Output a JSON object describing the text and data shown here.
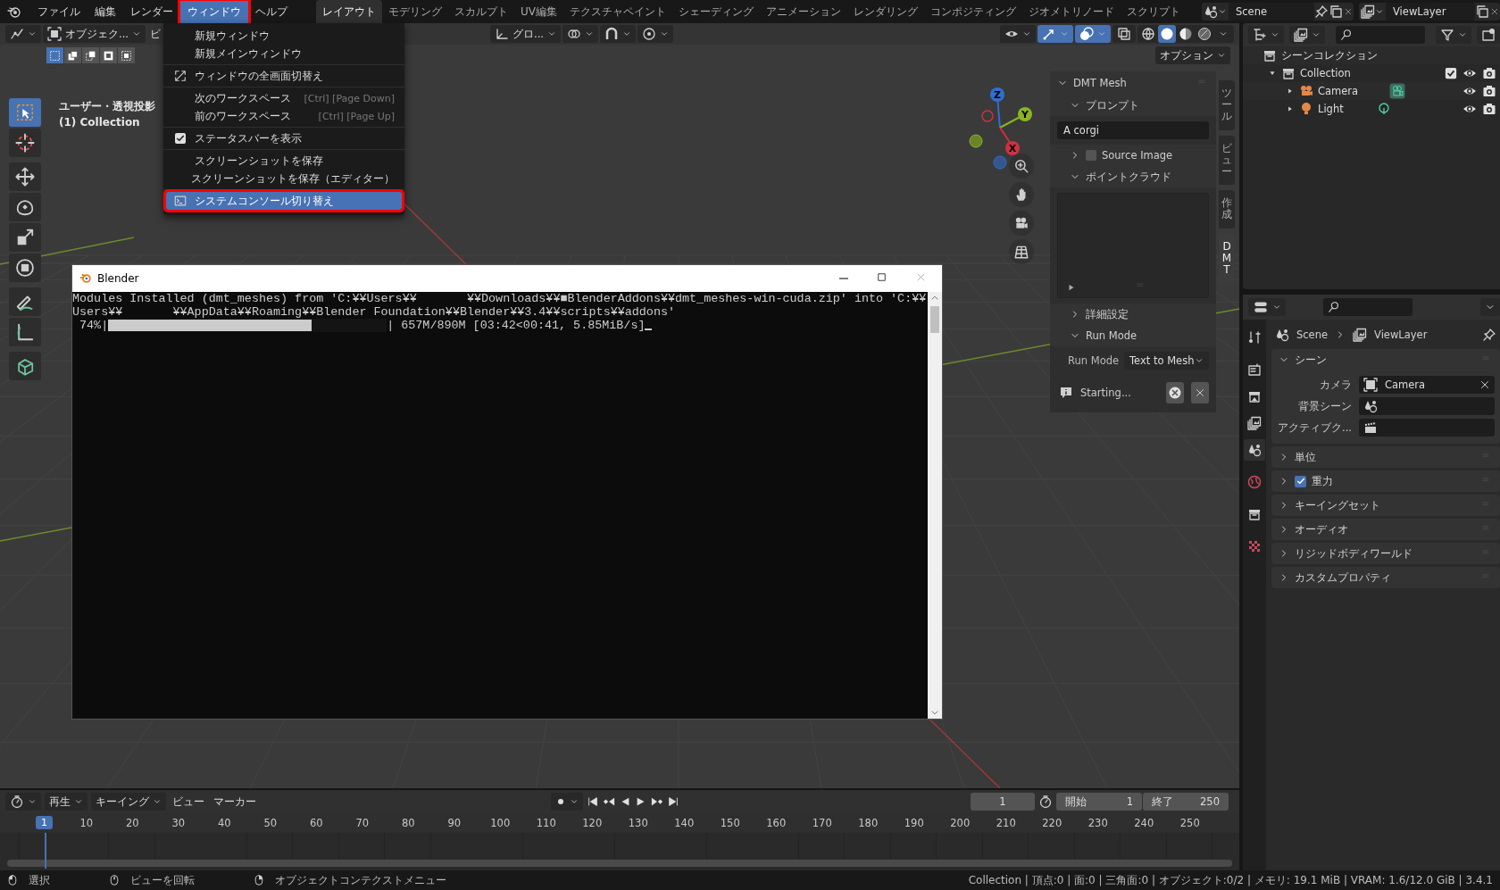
{
  "top_menu": [
    {
      "label": "ファイル",
      "selected": false,
      "highlighted": false
    },
    {
      "label": "編集",
      "selected": false,
      "highlighted": false
    },
    {
      "label": "レンダー",
      "selected": false,
      "highlighted": false
    },
    {
      "label": "ウィンドウ",
      "selected": true,
      "highlighted": true
    },
    {
      "label": "ヘルプ",
      "selected": false,
      "highlighted": false
    }
  ],
  "workspace_tabs": [
    {
      "label": "レイアウト",
      "selected": true
    },
    {
      "label": "モデリング",
      "selected": false
    },
    {
      "label": "スカルプト",
      "selected": false
    },
    {
      "label": "UV編集",
      "selected": false
    },
    {
      "label": "テクスチャペイント",
      "selected": false
    },
    {
      "label": "シェーディング",
      "selected": false
    },
    {
      "label": "アニメーション",
      "selected": false
    },
    {
      "label": "レンダリング",
      "selected": false
    },
    {
      "label": "コンポジティング",
      "selected": false
    },
    {
      "label": "ジオメトリノード",
      "selected": false
    },
    {
      "label": "スクリプト",
      "selected": false
    }
  ],
  "scene_selector": {
    "value": "Scene"
  },
  "view_layer_selector": {
    "value": "ViewLayer"
  },
  "viewport_header": {
    "mode": "オブジェク...",
    "view_menu": "ビ",
    "orientation": "グロ...",
    "options": "オプション"
  },
  "header_toggles_left": [
    {
      "kind": "snap",
      "on": false
    },
    {
      "kind": "proportional",
      "on": false
    }
  ],
  "header_toggles_right": [
    {
      "kind": "gizmo",
      "on": true
    },
    {
      "kind": "overlay",
      "on": true
    },
    {
      "kind": "xray",
      "on": false
    }
  ],
  "shading_modes": [
    {
      "kind": "wireframe",
      "selected": false
    },
    {
      "kind": "solid",
      "selected": true
    },
    {
      "kind": "material",
      "selected": false
    },
    {
      "kind": "rendered",
      "selected": false
    }
  ],
  "select_modes": [
    {
      "selected": true
    },
    {
      "selected": false
    },
    {
      "selected": false
    },
    {
      "selected": false
    },
    {
      "selected": false
    }
  ],
  "viewport_info": {
    "view_name": "ユーザー・透視投影",
    "collection": "(1) Collection"
  },
  "toolbar": [
    {
      "kind": "select",
      "selected": true
    },
    {
      "kind": "cursor",
      "selected": false
    },
    {
      "kind": "move",
      "selected": false
    },
    {
      "kind": "rotate",
      "selected": false
    },
    {
      "kind": "scale",
      "selected": false
    },
    {
      "kind": "transform",
      "selected": false
    },
    {
      "kind": "annotate",
      "selected": false
    },
    {
      "kind": "measure",
      "selected": false
    },
    {
      "kind": "add-cube",
      "selected": false
    }
  ],
  "gizmo": {
    "z": "Z",
    "y": "Y",
    "x": "X"
  },
  "navigation_buttons": [
    {
      "kind": "zoom"
    },
    {
      "kind": "hand"
    },
    {
      "kind": "camera"
    },
    {
      "kind": "grid"
    }
  ],
  "window_menu": {
    "groups": [
      [
        {
          "label": "新規ウィンドウ",
          "kind": "plain",
          "selected": false,
          "highlighted": false
        },
        {
          "label": "新規メインウィンドウ",
          "kind": "plain",
          "selected": false,
          "highlighted": false
        }
      ],
      [
        {
          "label": "ウィンドウの全画面切替え",
          "kind": "fullscreen",
          "selected": false,
          "highlighted": false
        }
      ],
      [
        {
          "label": "次のワークスペース",
          "shortcut": "[Ctrl] [Page Down]",
          "kind": "plain",
          "selected": false,
          "highlighted": false
        },
        {
          "label": "前のワークスペース",
          "shortcut": "[Ctrl] [Page Up]",
          "kind": "plain",
          "selected": false,
          "highlighted": false
        }
      ],
      [
        {
          "label": "ステータスバーを表示",
          "kind": "checkbox",
          "checked": true,
          "selected": false,
          "highlighted": false
        }
      ],
      [
        {
          "label": "スクリーンショットを保存",
          "kind": "plain",
          "selected": false,
          "highlighted": false
        },
        {
          "label": "スクリーンショットを保存（エディター）",
          "kind": "plain",
          "selected": false,
          "highlighted": false
        }
      ],
      [
        {
          "label": "システムコンソール切り替え",
          "kind": "console",
          "selected": true,
          "highlighted": true
        }
      ]
    ]
  },
  "console_window": {
    "title": "Blender",
    "lines": [
      "Modules Installed (dmt_meshes) from 'C:¥¥Users¥¥       ¥¥Downloads¥¥■BlenderAddons¥¥dmt_meshes-win-cuda.zip' into 'C:¥¥",
      "Users¥¥       ¥¥AppData¥¥Roaming¥¥Blender Foundation¥¥Blender¥¥3.4¥¥scripts¥¥addons'"
    ],
    "progress": {
      "prefix": " 74%|",
      "level": 0.73,
      "suffix": "| 657M/890M [03:42<00:41, 5.85MiB/s]"
    }
  },
  "n_panel": {
    "tabs": [
      {
        "label": "ツール",
        "selected": false
      },
      {
        "label": "ビュー",
        "selected": false
      },
      {
        "label": "作成",
        "selected": false
      },
      {
        "label": "DMT",
        "selected": true
      }
    ],
    "title": "DMT Mesh",
    "prompt_section": {
      "label": "プロンプト",
      "expanded": true
    },
    "prompt": "A corgi",
    "source_image": {
      "label": "Source Image",
      "checked": false,
      "expanded": false
    },
    "point_cloud_section": {
      "label": "ポイントクラウド",
      "expanded": true
    },
    "advanced_section": {
      "label": "詳細設定",
      "expanded": false
    },
    "run_mode_section": {
      "label": "Run Mode",
      "expanded": true
    },
    "run_mode": {
      "label": "Run Mode",
      "value": "Text to Mesh"
    },
    "status": "Starting..."
  },
  "outliner": {
    "root": "シーンコレクション",
    "items": [
      {
        "label": "Collection",
        "kind": "collection",
        "expanded": true,
        "checked": true,
        "children": [
          {
            "label": "Camera",
            "kind": "camera",
            "expanded": false
          },
          {
            "label": "Light",
            "kind": "light",
            "expanded": false
          }
        ]
      }
    ]
  },
  "properties": {
    "tabs": [
      {
        "kind": "tool",
        "selected": false
      },
      {
        "kind": "render",
        "selected": false
      },
      {
        "kind": "output",
        "selected": false
      },
      {
        "kind": "view-layer",
        "selected": false
      },
      {
        "kind": "scene",
        "selected": true
      },
      {
        "kind": "world",
        "selected": false
      },
      {
        "kind": "collection",
        "selected": false
      },
      {
        "kind": "texture",
        "selected": false
      }
    ],
    "breadcrumb": [
      {
        "kind": "scene",
        "label": "Scene"
      },
      {
        "kind": "view-layer",
        "label": "ViewLayer"
      }
    ],
    "panels": [
      {
        "label": "シーン",
        "kind": "plain",
        "expanded": true,
        "fields": [
          {
            "label": "カメラ",
            "kind": "camera",
            "value": "Camera"
          },
          {
            "label": "背景シーン",
            "kind": "scene"
          },
          {
            "label": "アクティブク...",
            "kind": "clip"
          }
        ]
      },
      {
        "label": "単位",
        "kind": "plain",
        "expanded": false
      },
      {
        "label": "重力",
        "kind": "checkbox",
        "checked": true,
        "expanded": false
      },
      {
        "label": "キーイングセット",
        "kind": "plain",
        "expanded": false
      },
      {
        "label": "オーディオ",
        "kind": "plain",
        "expanded": false
      },
      {
        "label": "リジッドボディワールド",
        "kind": "plain",
        "expanded": false
      },
      {
        "label": "カスタムプロパティ",
        "kind": "plain",
        "expanded": false
      }
    ]
  },
  "timeline": {
    "menus": [
      "再生",
      "キーイング",
      "ビュー",
      "マーカー"
    ],
    "current_frame": "1",
    "start_label": "開始",
    "start": "1",
    "end_label": "終了",
    "end": "250",
    "playhead": "1",
    "ruler": [
      "10",
      "20",
      "30",
      "40",
      "50",
      "60",
      "70",
      "80",
      "90",
      "100",
      "110",
      "120",
      "130",
      "140",
      "150",
      "160",
      "170",
      "180",
      "190",
      "200",
      "210",
      "220",
      "230",
      "240",
      "250"
    ]
  },
  "status_bar": {
    "hints": [
      {
        "kind": "left-click",
        "label": "選択"
      },
      {
        "kind": "middle-click",
        "label": "ビューを回転"
      },
      {
        "kind": "right-click",
        "label": "オブジェクトコンテクストメニュー"
      }
    ],
    "stats": "Collection | 頂点:0 | 面:0 | 三角面:0 | オブジェクト:0/2 | メモリ: 19.1 MiB | VRAM: 1.6/12.0 GiB | 3.4.1"
  }
}
